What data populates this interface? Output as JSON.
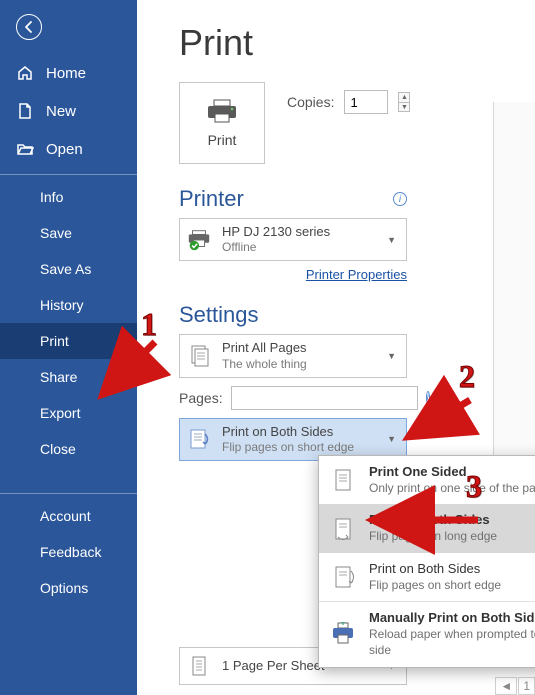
{
  "sidebar": {
    "home": "Home",
    "new": "New",
    "open": "Open",
    "info": "Info",
    "save": "Save",
    "saveas": "Save As",
    "history": "History",
    "print": "Print",
    "share": "Share",
    "export": "Export",
    "close": "Close",
    "account": "Account",
    "feedback": "Feedback",
    "options": "Options"
  },
  "page_title": "Print",
  "print_button": "Print",
  "copies": {
    "label": "Copies:",
    "value": "1"
  },
  "printer_section": "Printer",
  "printer": {
    "name": "HP DJ 2130 series",
    "status": "Offline"
  },
  "printer_props": "Printer Properties",
  "settings_section": "Settings",
  "print_all": {
    "t1": "Print All Pages",
    "t2": "The whole thing"
  },
  "pages_label": "Pages:",
  "duplex_sel": {
    "t1": "Print on Both Sides",
    "t2": "Flip pages on short edge"
  },
  "dropdown": {
    "one": {
      "t1": "Print One Sided",
      "t2": "Only print on one side of the page"
    },
    "long": {
      "t1": "Print on Both Sides",
      "t2": "Flip pages on long edge"
    },
    "short": {
      "t1": "Print on Both Sides",
      "t2": "Flip pages on short edge"
    },
    "manual": {
      "t1": "Manually Print on Both Sides",
      "t2": "Reload paper when prompted to print the second side"
    }
  },
  "sheets": {
    "t1": "1 Page Per Sheet"
  },
  "annotations": {
    "n1": "1",
    "n2": "2",
    "n3": "3"
  },
  "pgnav_arrow": "◄",
  "pgnav_num": "1"
}
